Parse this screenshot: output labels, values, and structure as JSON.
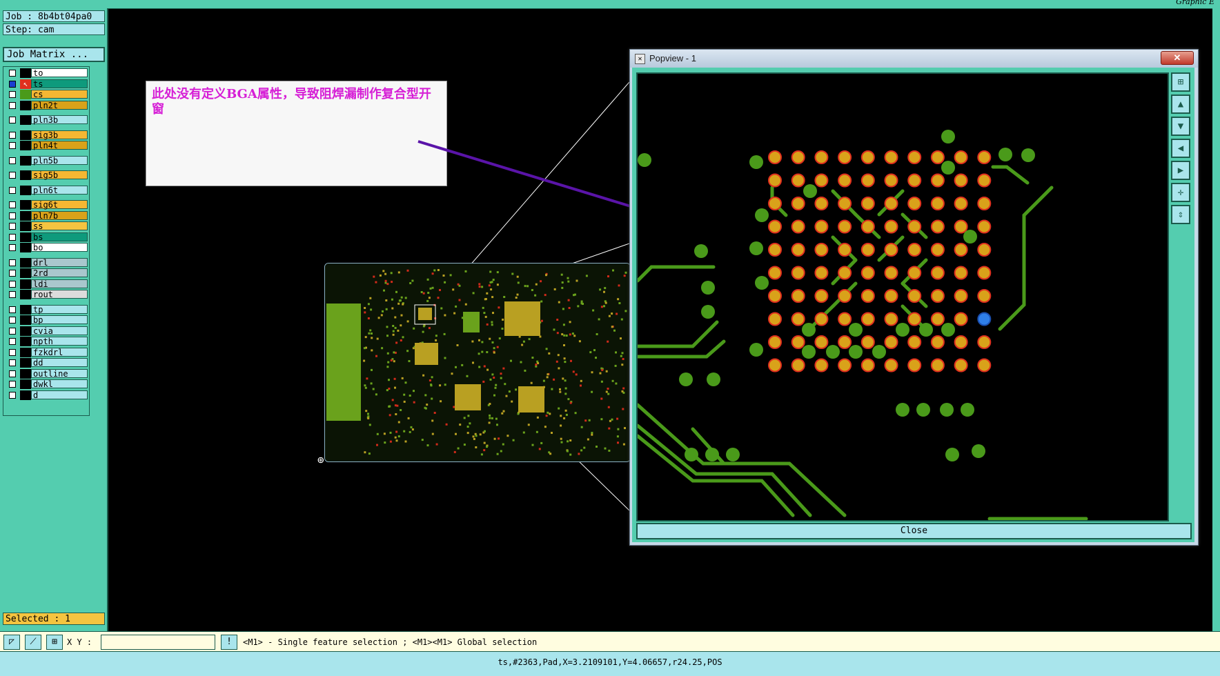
{
  "app": {
    "title": "Graphic E"
  },
  "job": {
    "job_text": "Job : 8b4bt04pa0",
    "step_text": "Step: cam",
    "matrix_button": "Job Matrix ..."
  },
  "layers": [
    {
      "name": "to",
      "color": "#ffffff",
      "state": "off"
    },
    {
      "name": "ts",
      "color": "#0e9a7c",
      "state": "active"
    },
    {
      "name": "cs",
      "color": "#f5b733",
      "state": "off"
    },
    {
      "name": "pln2t",
      "color": "#d9a21a",
      "state": "off"
    },
    {
      "name": "pln3b",
      "color": "#a9e5ec",
      "state": "off"
    },
    {
      "name": "sig3b",
      "color": "#f5b733",
      "state": "off"
    },
    {
      "name": "pln4t",
      "color": "#d9a21a",
      "state": "off"
    },
    {
      "name": "pln5b",
      "color": "#a9e5ec",
      "state": "off"
    },
    {
      "name": "sig5b",
      "color": "#f5b733",
      "state": "off"
    },
    {
      "name": "pln6t",
      "color": "#a9e5ec",
      "state": "off"
    },
    {
      "name": "sig6t",
      "color": "#f5b733",
      "state": "off"
    },
    {
      "name": "pln7b",
      "color": "#d9a21a",
      "state": "off"
    },
    {
      "name": "ss",
      "color": "#f5c440",
      "state": "off"
    },
    {
      "name": "bs",
      "color": "#0e9a7c",
      "state": "off"
    },
    {
      "name": "bo",
      "color": "#ffffff",
      "state": "off"
    },
    {
      "name": "drl",
      "color": "#a9c7cd",
      "state": "off"
    },
    {
      "name": "2rd",
      "color": "#a9c7cd",
      "state": "off"
    },
    {
      "name": "ldi",
      "color": "#a9c7cd",
      "state": "off"
    },
    {
      "name": "rout",
      "color": "#dcdcdc",
      "state": "off"
    },
    {
      "name": "tp",
      "color": "#a9e5ec",
      "state": "off"
    },
    {
      "name": "bp",
      "color": "#a9e5ec",
      "state": "off"
    },
    {
      "name": "cvia",
      "color": "#a9e5ec",
      "state": "off"
    },
    {
      "name": "npth",
      "color": "#a9e5ec",
      "state": "off"
    },
    {
      "name": "fzkdrl",
      "color": "#a9e5ec",
      "state": "off"
    },
    {
      "name": "dd",
      "color": "#a9e5ec",
      "state": "off"
    },
    {
      "name": "outline",
      "color": "#a9e5ec",
      "state": "off"
    },
    {
      "name": "dwkl",
      "color": "#a9e5ec",
      "state": "off"
    },
    {
      "name": "d",
      "color": "#a9e5ec",
      "state": "off"
    }
  ],
  "selected_text": "Selected : 1",
  "annotation": {
    "text": "此处没有定义BGA属性，导致阻焊漏制作复合型开窗",
    "color": "#d61fd6"
  },
  "popview": {
    "title": "Popview - 1",
    "close_x": "✕",
    "close_label": "Close"
  },
  "toolbar": {
    "xy_label": "X Y :",
    "xy_value": "",
    "hint": "<M1> - Single feature selection ; <M1><M1> Global selection"
  },
  "status": "ts,#2363,Pad,X=3.2109101,Y=4.06657,r24.25,POS",
  "colors": {
    "panel": "#54cdaf",
    "pad": "#d9a21a",
    "pad_ring": "#e0301e",
    "trace": "#4a9a1a",
    "selected_pad": "#2f7fe8"
  }
}
